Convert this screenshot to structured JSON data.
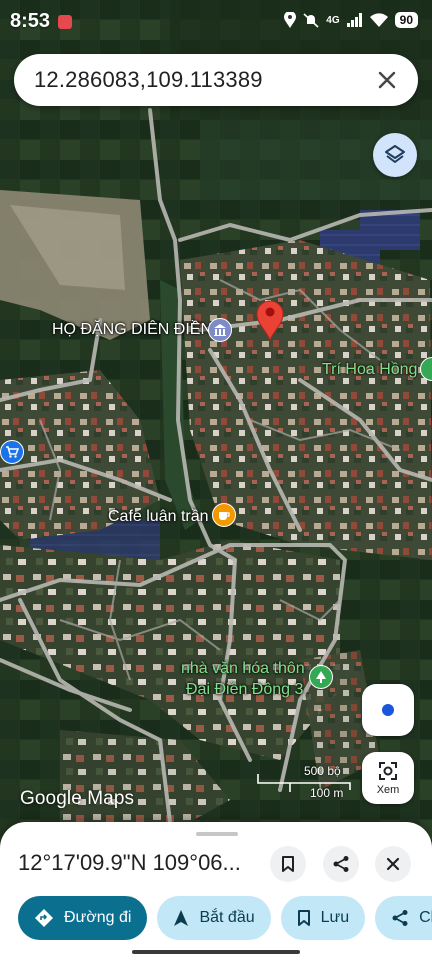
{
  "status_bar": {
    "time": "8:53",
    "network": "4G",
    "battery": "90"
  },
  "search": {
    "value": "12.286083,109.113389"
  },
  "map": {
    "labels": {
      "clan_hall": "HỌ ĐẶNG DIÊN ĐIỀN",
      "shop": "Trí Hoa Hồng",
      "cafe": "Cafe luân trần",
      "culture_house_line1": "nhà văn hóa thôn",
      "culture_house_line2": "Đại Điền Đông 3"
    },
    "scale": {
      "imperial": "500 bộ",
      "metric": "100 m"
    },
    "attribution": "Google Maps",
    "pin_color": "#ea4335"
  },
  "controls": {
    "explore_label": "Xem"
  },
  "sheet": {
    "coordinates": "12°17'09.9\"N 109°06...",
    "actions": [
      {
        "label": "Đường đi",
        "icon": "directions-icon"
      },
      {
        "label": "Bắt đầu",
        "icon": "navigation-arrow-icon"
      },
      {
        "label": "Lưu",
        "icon": "bookmark-icon"
      },
      {
        "label": "Ch",
        "icon": "share-icon"
      }
    ]
  },
  "colors": {
    "primary_chip": "#0b6f8f",
    "tonal_chip": "#c2e7f7"
  }
}
